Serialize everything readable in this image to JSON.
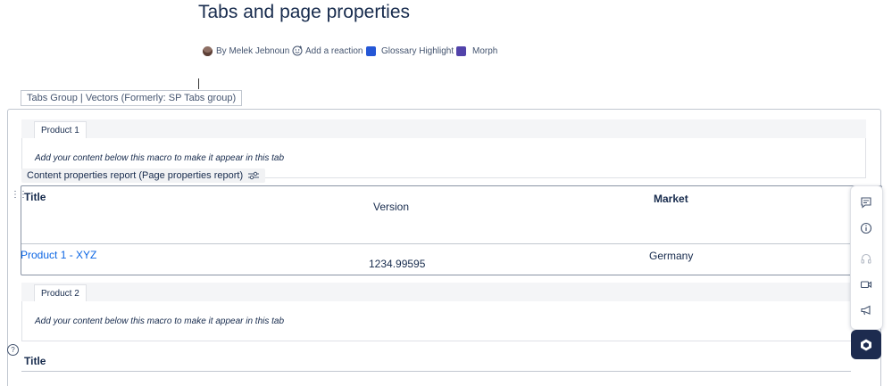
{
  "page": {
    "title": "Tabs and page properties"
  },
  "byline": {
    "author": "By Melek Jebnoun",
    "reaction": "Add a reaction",
    "glossary": "Glossary Highlight",
    "morph": "Morph"
  },
  "tabs_group": {
    "label": "Tabs Group | Vectors (Formerly: SP Tabs group)"
  },
  "tab1": {
    "label": "Product 1",
    "hint": "Add your content below this macro to make it appear in this tab"
  },
  "report_macro": {
    "label": "Content properties report (Page properties report)"
  },
  "report": {
    "headers": [
      "Title",
      "Version",
      "Market"
    ],
    "rows": [
      {
        "title": "Product 1 - XYZ",
        "version": "1234.99595",
        "market": "Germany"
      }
    ]
  },
  "tab2": {
    "label": "Product 2",
    "hint": "Add your content below this macro to make it appear in this tab"
  },
  "second_report": {
    "title_header": "Title"
  },
  "colors": {
    "link": "#0c66e4",
    "ai_button": "#1d2b4f",
    "glossary_icon": "#2557d6",
    "morph_icon": "#5243aa"
  }
}
